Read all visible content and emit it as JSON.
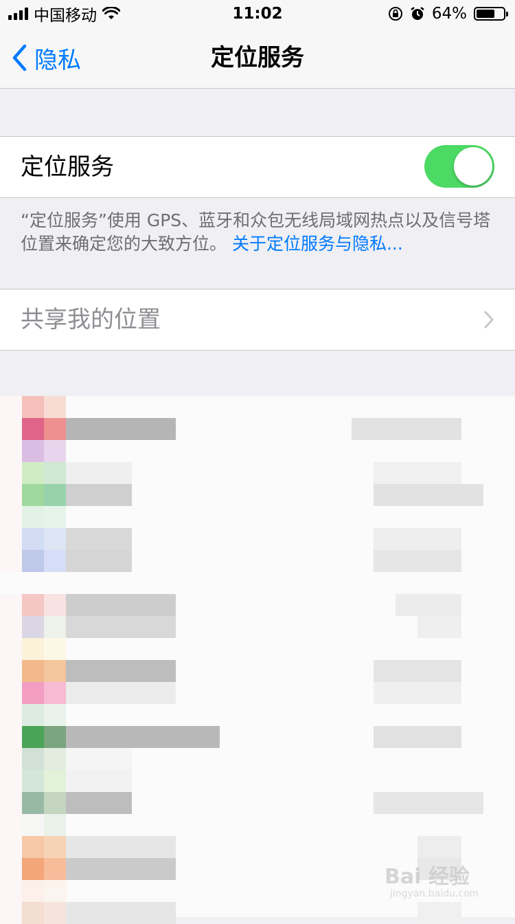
{
  "status_bar": {
    "carrier": "中国移动",
    "time": "11:02",
    "battery_percent": "64%",
    "battery_level": 0.64,
    "icons": [
      "signal-icon",
      "wifi-icon",
      "orientation-lock-icon",
      "alarm-icon",
      "battery-icon"
    ]
  },
  "nav": {
    "back_label": "隐私",
    "title": "定位服务"
  },
  "location_row": {
    "label": "定位服务",
    "toggle_on": true
  },
  "footer_note": {
    "text": "“定位服务”使用 GPS、蓝牙和众包无线局域网热点以及信号塔位置来确定您的大致方位。",
    "link": "关于定位服务与隐私..."
  },
  "share_row": {
    "label": "共享我的位置"
  },
  "watermark": {
    "text": "Bai 经验",
    "sub": "jingyan.baidu.com"
  },
  "colors": {
    "accent": "#007aff",
    "toggle_on": "#4cd964",
    "group_bg": "#efeff4"
  }
}
